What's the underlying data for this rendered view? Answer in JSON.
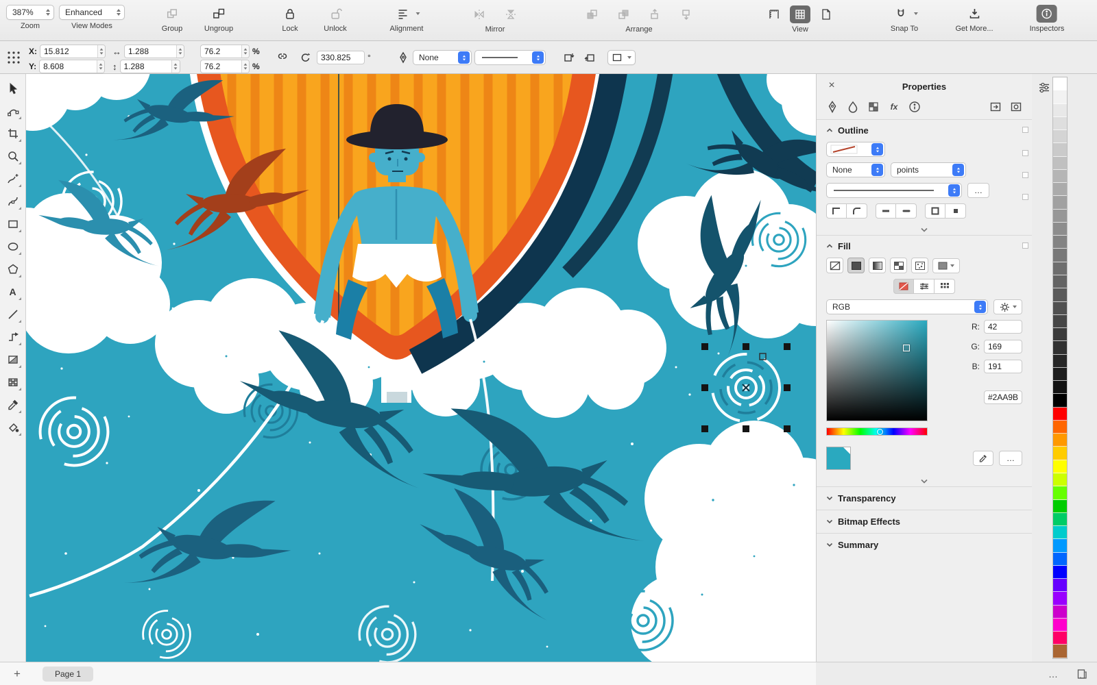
{
  "icons": {
    "close": "×",
    "more": "…",
    "add_page": "+",
    "width_arrow": "↔",
    "height_arrow": "↕",
    "text_tool": "A",
    "fx_tab": "fx"
  },
  "toolbar": {
    "zoom": {
      "value": "387%",
      "caption": "Zoom"
    },
    "view_modes": {
      "value": "Enhanced",
      "caption": "View Modes"
    },
    "group_caption": "Group",
    "ungroup_caption": "Ungroup",
    "lock_caption": "Lock",
    "unlock_caption": "Unlock",
    "alignment_caption": "Alignment",
    "mirror_caption": "Mirror",
    "arrange_caption": "Arrange",
    "view_caption": "View",
    "snap_to_caption": "Snap To",
    "get_more_caption": "Get More...",
    "inspectors_caption": "Inspectors"
  },
  "property_bar": {
    "x_label": "X:",
    "x_value": "15.812",
    "y_label": "Y:",
    "y_value": "8.608",
    "width_value": "1.288",
    "height_value": "1.288",
    "scale_width_value": "76.2",
    "scale_height_value": "76.2",
    "percent_sign": "%",
    "rotation_value": "330.825",
    "degree_sign": "°",
    "outline_width_value": "None"
  },
  "properties_panel": {
    "title": "Properties",
    "outline_section": {
      "title": "Outline",
      "width_value": "None",
      "units_value": "points"
    },
    "fill_section": {
      "title": "Fill",
      "color_model": "RGB",
      "r_label": "R:",
      "g_label": "G:",
      "b_label": "B:",
      "r_value": "42",
      "g_value": "169",
      "b_value": "191",
      "hex_value": "#2AA9BF"
    },
    "transparency_title": "Transparency",
    "bitmap_effects_title": "Bitmap Effects",
    "summary_title": "Summary"
  },
  "bottom_bar": {
    "page_tab": "Page 1"
  },
  "palette": {
    "colors": [
      "#FFFFFF",
      "#F2F2F2",
      "#E8E8E8",
      "#DEDEDE",
      "#D4D4D4",
      "#CACACA",
      "#C0C0C0",
      "#B5B5B5",
      "#ABABAB",
      "#A1A1A1",
      "#979797",
      "#8D8D8D",
      "#838383",
      "#787878",
      "#6E6E6E",
      "#646464",
      "#5A5A5A",
      "#505050",
      "#464646",
      "#3B3B3B",
      "#313131",
      "#272727",
      "#1D1D1D",
      "#131313",
      "#000000",
      "#FF0000",
      "#FF6600",
      "#FF9900",
      "#FFCC00",
      "#FFFF00",
      "#CCFF00",
      "#66FF00",
      "#00CC00",
      "#00CC66",
      "#00CCCC",
      "#0099FF",
      "#0066FF",
      "#0000FF",
      "#6600FF",
      "#9900FF",
      "#CC00CC",
      "#FF00CC",
      "#FF0066",
      "#AA6633"
    ]
  },
  "art": {
    "background": "#2EA4BF",
    "selected_fill": "#2AA9BF"
  }
}
